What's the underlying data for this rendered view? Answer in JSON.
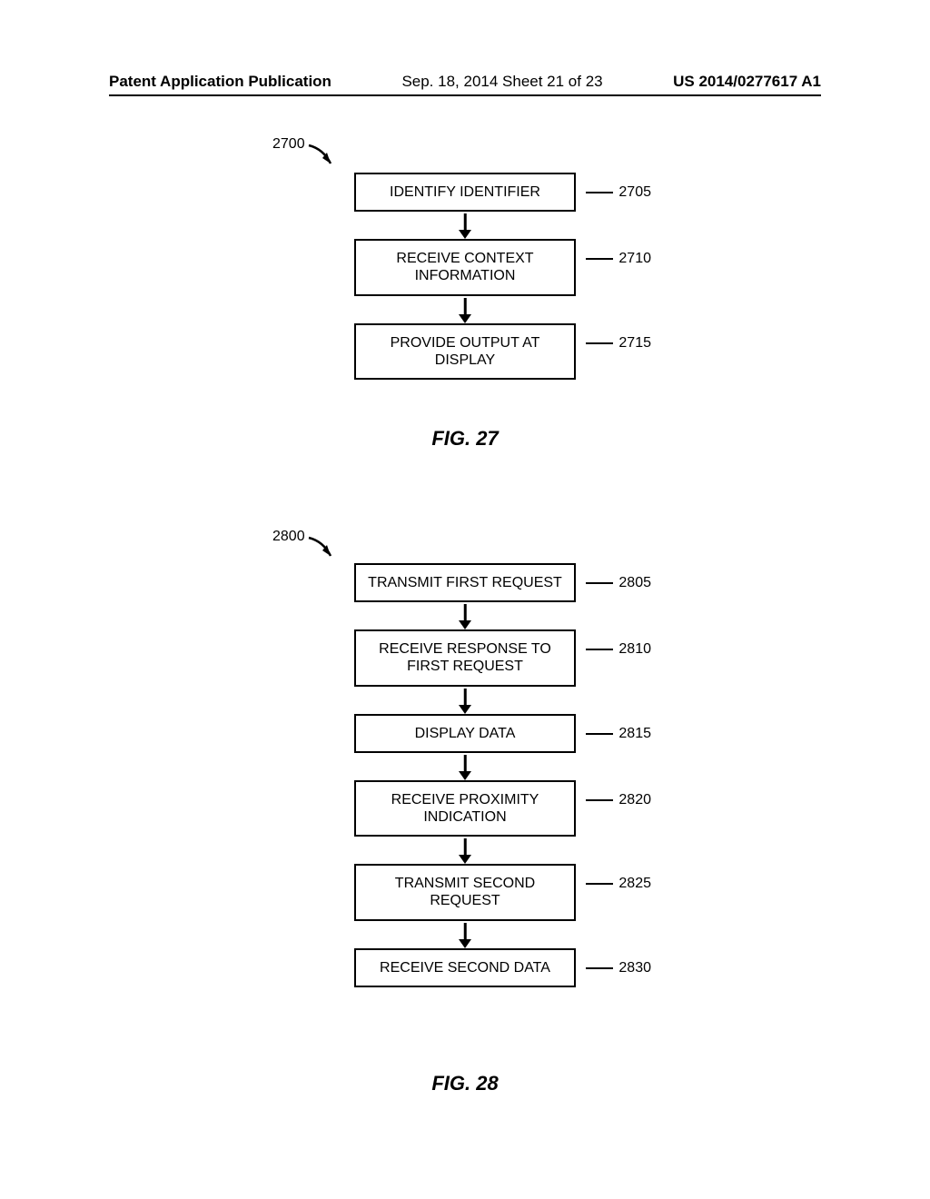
{
  "header": {
    "left": "Patent Application Publication",
    "mid": "Sep. 18, 2014  Sheet 21 of 23",
    "right": "US 2014/0277617 A1"
  },
  "fig27": {
    "start_ref": "2700",
    "steps": [
      {
        "text": "IDENTIFY IDENTIFIER",
        "ref": "2705"
      },
      {
        "text": "RECEIVE CONTEXT INFORMATION",
        "ref": "2710"
      },
      {
        "text": "PROVIDE OUTPUT AT DISPLAY",
        "ref": "2715"
      }
    ],
    "caption": "FIG. 27"
  },
  "fig28": {
    "start_ref": "2800",
    "steps": [
      {
        "text": "TRANSMIT FIRST REQUEST",
        "ref": "2805"
      },
      {
        "text": "RECEIVE RESPONSE TO FIRST REQUEST",
        "ref": "2810"
      },
      {
        "text": "DISPLAY DATA",
        "ref": "2815"
      },
      {
        "text": "RECEIVE PROXIMITY INDICATION",
        "ref": "2820"
      },
      {
        "text": "TRANSMIT SECOND REQUEST",
        "ref": "2825"
      },
      {
        "text": "RECEIVE SECOND DATA",
        "ref": "2830"
      }
    ],
    "caption": "FIG. 28"
  }
}
